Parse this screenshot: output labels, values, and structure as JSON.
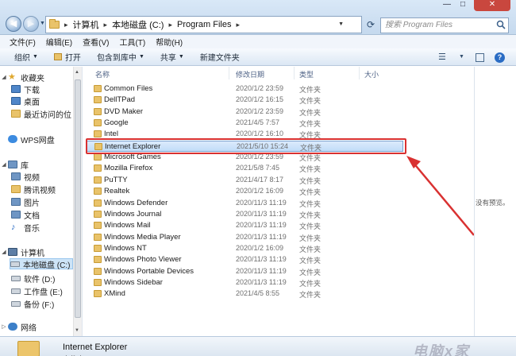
{
  "address": {
    "crumbs": [
      "计算机",
      "本地磁盘 (C:)",
      "Program Files"
    ],
    "search_placeholder": "搜索 Program Files"
  },
  "menu": [
    "文件(F)",
    "编辑(E)",
    "查看(V)",
    "工具(T)",
    "帮助(H)"
  ],
  "toolbar": {
    "organize": "组织",
    "open": "打开",
    "include": "包含到库中",
    "share": "共享",
    "new_folder": "新建文件夹"
  },
  "sidebar": {
    "favorites": "收藏夹",
    "downloads": "下载",
    "desktop": "桌面",
    "recent": "最近访问的位",
    "wps": "WPS网盘",
    "library": "库",
    "video": "视频",
    "tencent_video": "腾讯视频",
    "pictures": "图片",
    "documents": "文档",
    "music": "音乐",
    "computer": "计算机",
    "drive_c": "本地磁盘 (C:)",
    "drive_d": "软件 (D:)",
    "drive_e": "工作盘 (E:)",
    "drive_f": "备份 (F:)",
    "network": "网络"
  },
  "columns": {
    "name": "名称",
    "date": "修改日期",
    "type": "类型",
    "size": "大小"
  },
  "files": [
    {
      "name": "Common Files",
      "date": "2020/1/2 23:59",
      "type": "文件夹"
    },
    {
      "name": "DellTPad",
      "date": "2020/1/2 16:15",
      "type": "文件夹"
    },
    {
      "name": "DVD Maker",
      "date": "2020/1/2 23:59",
      "type": "文件夹"
    },
    {
      "name": "Google",
      "date": "2021/4/5 7:57",
      "type": "文件夹"
    },
    {
      "name": "Intel",
      "date": "2020/1/2 16:10",
      "type": "文件夹"
    },
    {
      "name": "Internet Explorer",
      "date": "2021/5/10 15:24",
      "type": "文件夹"
    },
    {
      "name": "Microsoft Games",
      "date": "2020/1/2 23:59",
      "type": "文件夹"
    },
    {
      "name": "Mozilla Firefox",
      "date": "2021/5/8 7:45",
      "type": "文件夹"
    },
    {
      "name": "PuTTY",
      "date": "2021/4/17 8:17",
      "type": "文件夹"
    },
    {
      "name": "Realtek",
      "date": "2020/1/2 16:09",
      "type": "文件夹"
    },
    {
      "name": "Windows Defender",
      "date": "2020/11/3 11:19",
      "type": "文件夹"
    },
    {
      "name": "Windows Journal",
      "date": "2020/11/3 11:19",
      "type": "文件夹"
    },
    {
      "name": "Windows Mail",
      "date": "2020/11/3 11:19",
      "type": "文件夹"
    },
    {
      "name": "Windows Media Player",
      "date": "2020/11/3 11:19",
      "type": "文件夹"
    },
    {
      "name": "Windows NT",
      "date": "2020/1/2 16:09",
      "type": "文件夹"
    },
    {
      "name": "Windows Photo Viewer",
      "date": "2020/11/3 11:19",
      "type": "文件夹"
    },
    {
      "name": "Windows Portable Devices",
      "date": "2020/11/3 11:19",
      "type": "文件夹"
    },
    {
      "name": "Windows Sidebar",
      "date": "2020/11/3 11:19",
      "type": "文件夹"
    },
    {
      "name": "XMind",
      "date": "2021/4/5 8:55",
      "type": "文件夹"
    }
  ],
  "preview": "没有预览。",
  "details": {
    "name": "Internet Explorer",
    "type": "文件夹"
  },
  "watermark": "电脑x家",
  "colors": {
    "highlight": "#d93131",
    "selection": "#c1dcf8"
  }
}
